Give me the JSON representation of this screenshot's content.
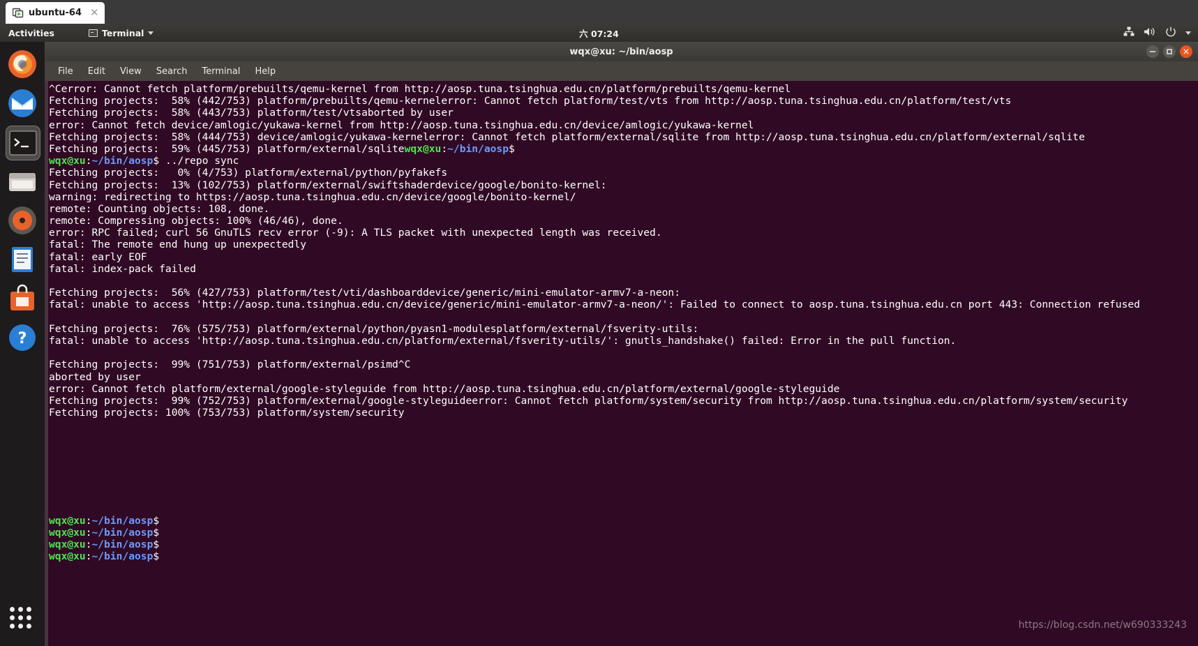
{
  "vmware": {
    "tab_label": "ubuntu-64",
    "tab_icon": "vm-window-icon",
    "tab_close_icon": "close-icon"
  },
  "gnome_topbar": {
    "activities_label": "Activities",
    "app_menu_label": "Terminal",
    "app_menu_icon": "terminal-icon",
    "app_menu_caret_icon": "chevron-down-icon",
    "clock": "六 07:24",
    "tray_icons": [
      "network-wired-icon",
      "volume-icon",
      "power-icon",
      "chevron-down-icon"
    ]
  },
  "dock": {
    "items": [
      {
        "name": "firefox",
        "label": "Firefox"
      },
      {
        "name": "thunderbird",
        "label": "Thunderbird"
      },
      {
        "name": "terminal",
        "label": "Terminal"
      },
      {
        "name": "files",
        "label": "Files"
      },
      {
        "name": "rhythmbox",
        "label": "Rhythmbox"
      },
      {
        "name": "libreoffice-writer",
        "label": "LibreOffice Writer"
      },
      {
        "name": "ubuntu-software",
        "label": "Ubuntu Software"
      },
      {
        "name": "help",
        "label": "Help"
      }
    ],
    "show_apps_label": "Show Applications"
  },
  "terminal": {
    "title": "wqx@xu: ~/bin/aosp",
    "window_controls": {
      "minimize": "minimize-button",
      "maximize": "maximize-button",
      "close": "close-button"
    },
    "menu": [
      "File",
      "Edit",
      "View",
      "Search",
      "Terminal",
      "Help"
    ],
    "colors": {
      "background": "#300a24",
      "foreground": "#ffffff",
      "prompt_user": "#4ee44e",
      "prompt_path": "#6a9bff",
      "accent_close": "#e95420"
    },
    "prompt": {
      "user_host": "wqx@xu",
      "colon": ":",
      "path": "~/bin/aosp",
      "sigil": "$"
    },
    "lines": [
      {
        "type": "plain",
        "text": "^Cerror: Cannot fetch platform/prebuilts/qemu-kernel from http://aosp.tuna.tsinghua.edu.cn/platform/prebuilts/qemu-kernel"
      },
      {
        "type": "plain",
        "text": "Fetching projects:  58% (442/753) platform/prebuilts/qemu-kernelerror: Cannot fetch platform/test/vts from http://aosp.tuna.tsinghua.edu.cn/platform/test/vts"
      },
      {
        "type": "plain",
        "text": "Fetching projects:  58% (443/753) platform/test/vtsaborted by user"
      },
      {
        "type": "plain",
        "text": "error: Cannot fetch device/amlogic/yukawa-kernel from http://aosp.tuna.tsinghua.edu.cn/device/amlogic/yukawa-kernel"
      },
      {
        "type": "plain",
        "text": "Fetching projects:  58% (444/753) device/amlogic/yukawa-kernelerror: Cannot fetch platform/external/sqlite from http://aosp.tuna.tsinghua.edu.cn/platform/external/sqlite"
      },
      {
        "type": "plain_then_prompt",
        "text": "Fetching projects:  59% (445/753) platform/external/sqlite"
      },
      {
        "type": "prompt_cmd",
        "command": "../repo sync"
      },
      {
        "type": "plain",
        "text": "Fetching projects:   0% (4/753) platform/external/python/pyfakefs"
      },
      {
        "type": "plain",
        "text": "Fetching projects:  13% (102/753) platform/external/swiftshaderdevice/google/bonito-kernel:"
      },
      {
        "type": "plain",
        "text": "warning: redirecting to https://aosp.tuna.tsinghua.edu.cn/device/google/bonito-kernel/"
      },
      {
        "type": "plain",
        "text": "remote: Counting objects: 108, done."
      },
      {
        "type": "plain",
        "text": "remote: Compressing objects: 100% (46/46), done."
      },
      {
        "type": "plain",
        "text": "error: RPC failed; curl 56 GnuTLS recv error (-9): A TLS packet with unexpected length was received."
      },
      {
        "type": "plain",
        "text": "fatal: The remote end hung up unexpectedly"
      },
      {
        "type": "plain",
        "text": "fatal: early EOF"
      },
      {
        "type": "plain",
        "text": "fatal: index-pack failed"
      },
      {
        "type": "plain",
        "text": ""
      },
      {
        "type": "plain",
        "text": "Fetching projects:  56% (427/753) platform/test/vti/dashboarddevice/generic/mini-emulator-armv7-a-neon:"
      },
      {
        "type": "plain",
        "text": "fatal: unable to access 'http://aosp.tuna.tsinghua.edu.cn/device/generic/mini-emulator-armv7-a-neon/': Failed to connect to aosp.tuna.tsinghua.edu.cn port 443: Connection refused"
      },
      {
        "type": "plain",
        "text": ""
      },
      {
        "type": "plain",
        "text": "Fetching projects:  76% (575/753) platform/external/python/pyasn1-modulesplatform/external/fsverity-utils:"
      },
      {
        "type": "plain",
        "text": "fatal: unable to access 'http://aosp.tuna.tsinghua.edu.cn/platform/external/fsverity-utils/': gnutls_handshake() failed: Error in the pull function."
      },
      {
        "type": "plain",
        "text": ""
      },
      {
        "type": "plain",
        "text": "Fetching projects:  99% (751/753) platform/external/psimd^C"
      },
      {
        "type": "plain",
        "text": "aborted by user"
      },
      {
        "type": "plain",
        "text": "error: Cannot fetch platform/external/google-styleguide from http://aosp.tuna.tsinghua.edu.cn/platform/external/google-styleguide"
      },
      {
        "type": "plain",
        "text": "Fetching projects:  99% (752/753) platform/external/google-styleguideerror: Cannot fetch platform/system/security from http://aosp.tuna.tsinghua.edu.cn/platform/system/security"
      },
      {
        "type": "plain",
        "text": "Fetching projects: 100% (753/753) platform/system/security"
      },
      {
        "type": "blank",
        "count": 8
      },
      {
        "type": "prompt_only"
      },
      {
        "type": "prompt_only"
      },
      {
        "type": "prompt_only"
      },
      {
        "type": "prompt_cursor"
      }
    ]
  },
  "watermark": {
    "text": "https://blog.csdn.net/w690333243"
  }
}
